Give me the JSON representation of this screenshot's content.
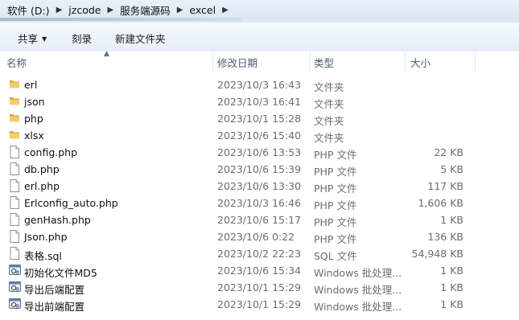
{
  "breadcrumb": [
    "软件 (D:)",
    "jzcode",
    "服务端源码",
    "excel"
  ],
  "toolbar": {
    "share_label": "共享",
    "burn_label": "刻录",
    "new_folder_label": "新建文件夹"
  },
  "columns": {
    "name": "名称",
    "date": "修改日期",
    "type": "类型",
    "size": "大小"
  },
  "files": [
    {
      "name": "erl",
      "date": "2023/10/3 16:43",
      "type": "文件夹",
      "size": "",
      "icon": "folder-icon"
    },
    {
      "name": "json",
      "date": "2023/10/3 16:41",
      "type": "文件夹",
      "size": "",
      "icon": "folder-icon"
    },
    {
      "name": "php",
      "date": "2023/10/1 15:28",
      "type": "文件夹",
      "size": "",
      "icon": "folder-icon"
    },
    {
      "name": "xlsx",
      "date": "2023/10/6 15:40",
      "type": "文件夹",
      "size": "",
      "icon": "folder-icon"
    },
    {
      "name": "config.php",
      "date": "2023/10/6 13:53",
      "type": "PHP 文件",
      "size": "22 KB",
      "icon": "file-icon"
    },
    {
      "name": "db.php",
      "date": "2023/10/6 15:39",
      "type": "PHP 文件",
      "size": "5 KB",
      "icon": "file-icon"
    },
    {
      "name": "erl.php",
      "date": "2023/10/6 13:30",
      "type": "PHP 文件",
      "size": "117 KB",
      "icon": "file-icon"
    },
    {
      "name": "Erlconfig_auto.php",
      "date": "2023/10/3 16:46",
      "type": "PHP 文件",
      "size": "1,606 KB",
      "icon": "file-icon"
    },
    {
      "name": "genHash.php",
      "date": "2023/10/6 15:17",
      "type": "PHP 文件",
      "size": "1 KB",
      "icon": "file-icon"
    },
    {
      "name": "Json.php",
      "date": "2023/10/6 0:22",
      "type": "PHP 文件",
      "size": "136 KB",
      "icon": "file-icon"
    },
    {
      "name": "表格.sql",
      "date": "2023/10/2 22:23",
      "type": "SQL 文件",
      "size": "54,948 KB",
      "icon": "file-icon"
    },
    {
      "name": "初始化文件MD5",
      "date": "2023/10/6 15:34",
      "type": "Windows 批处理...",
      "size": "1 KB",
      "icon": "batch-file-icon"
    },
    {
      "name": "导出后端配置",
      "date": "2023/10/1 15:29",
      "type": "Windows 批处理...",
      "size": "1 KB",
      "icon": "batch-file-icon"
    },
    {
      "name": "导出前端配置",
      "date": "2023/10/1 15:29",
      "type": "Windows 批处理...",
      "size": "1 KB",
      "icon": "batch-file-icon"
    }
  ],
  "colors": {
    "folder": "#e8b94a",
    "text_primary": "#111111",
    "text_secondary": "#6d6d6d",
    "header_text": "#4b5b74"
  }
}
